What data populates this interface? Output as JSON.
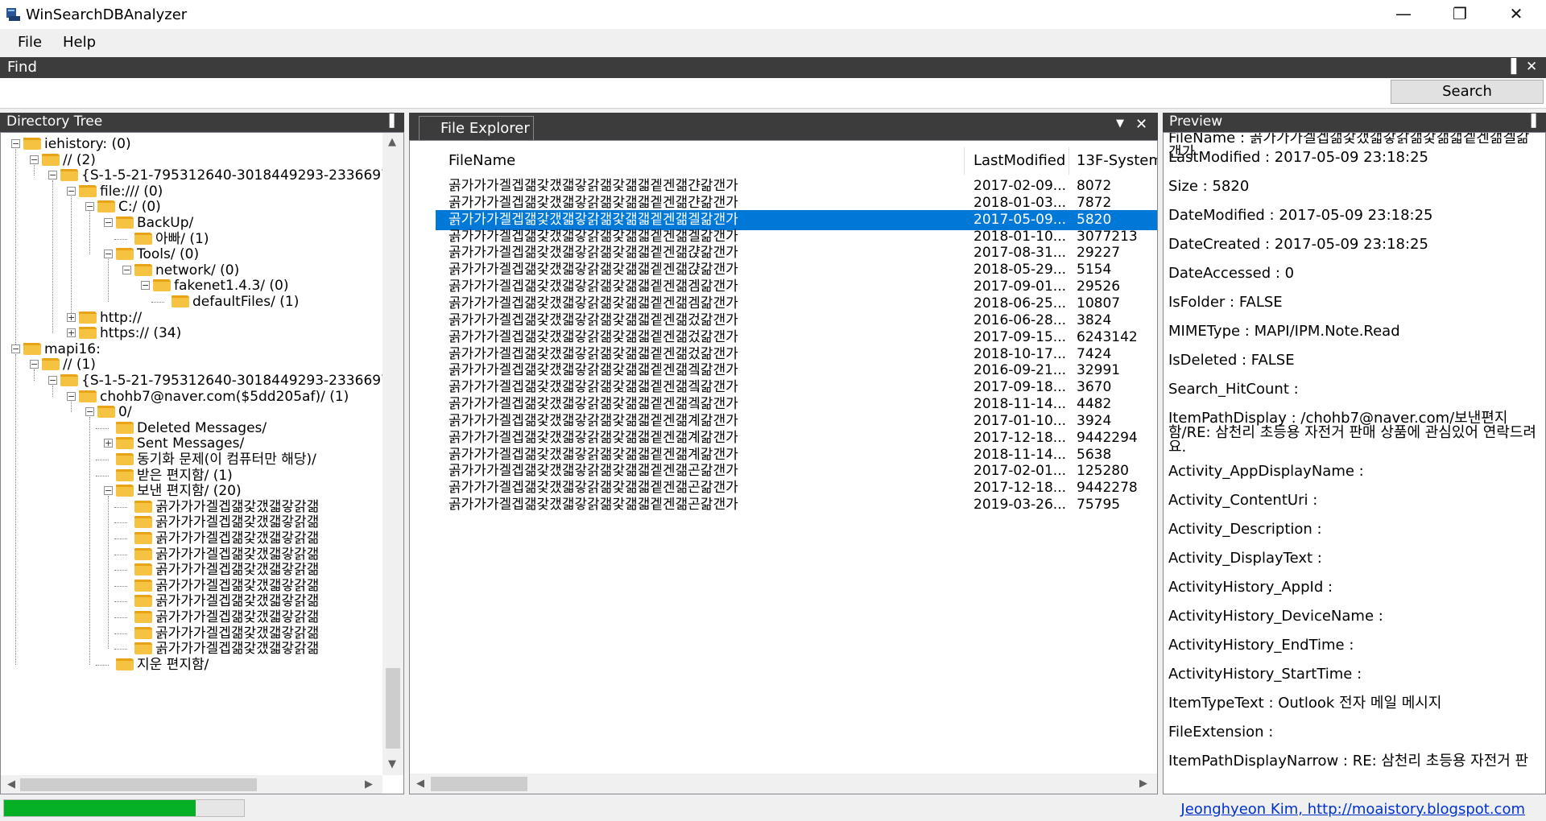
{
  "window": {
    "title": "WinSearchDBAnalyzer",
    "minimize_glyph": "—",
    "maximize_glyph": "❐",
    "close_glyph": "✕"
  },
  "menu": {
    "file": "File",
    "help": "Help"
  },
  "find": {
    "title": "Find",
    "search_value": "",
    "search_button": "Search"
  },
  "directory_tree": {
    "title": "Directory Tree",
    "nodes": [
      {
        "label": "iehistory: (0)",
        "expander": "−"
      },
      {
        "label": "// (2)",
        "expander": "−"
      },
      {
        "label": "{S-1-5-21-795312640-3018449293-2336697",
        "expander": "−"
      },
      {
        "label": "file:/// (0)",
        "expander": "−"
      },
      {
        "label": "C:/ (0)",
        "expander": "−"
      },
      {
        "label": "BackUp/",
        "expander": "−"
      },
      {
        "label": "아빠/ (1)",
        "expander": ""
      },
      {
        "label": "Tools/ (0)",
        "expander": "−"
      },
      {
        "label": "network/ (0)",
        "expander": "−"
      },
      {
        "label": "fakenet1.4.3/ (0)",
        "expander": "−"
      },
      {
        "label": "defaultFiles/ (1)",
        "expander": ""
      },
      {
        "label": "http://",
        "expander": "+"
      },
      {
        "label": "https:// (34)",
        "expander": "+"
      },
      {
        "label": "mapi16:",
        "expander": "−"
      },
      {
        "label": "// (1)",
        "expander": "−"
      },
      {
        "label": "{S-1-5-21-795312640-3018449293-2336697",
        "expander": "−"
      },
      {
        "label": "chohb7@naver.com($5dd205af)/ (1)",
        "expander": "−"
      },
      {
        "label": "0/",
        "expander": "−"
      },
      {
        "label": "Deleted Messages/",
        "expander": ""
      },
      {
        "label": "Sent Messages/",
        "expander": "+"
      },
      {
        "label": "동기화 문제(이 컴퓨터만 해당)/",
        "expander": ""
      },
      {
        "label": "받은 편지함/ (1)",
        "expander": ""
      },
      {
        "label": "보낸 편지함/ (20)",
        "expander": "−"
      },
      {
        "label": "곩가가가겔겝갦갗갰갧갛갉갦",
        "expander": ""
      },
      {
        "label": "곩가가가겔겝갦갗갰갧갛갉갦",
        "expander": ""
      },
      {
        "label": "곩가가가겔겝갦갗갰갧갛갉갦",
        "expander": ""
      },
      {
        "label": "곩가가가겔겝갦갗갰갧갛갉갦",
        "expander": ""
      },
      {
        "label": "곩가가가겔겝갦갗갰갧갛갉갦",
        "expander": ""
      },
      {
        "label": "곩가가가겔겝갦갗갰갧갛갉갦",
        "expander": ""
      },
      {
        "label": "곩가가가겔겝갦갗갰갧갛갉갦",
        "expander": ""
      },
      {
        "label": "곩가가가겔겝갦갗갰갧갛갉갦",
        "expander": ""
      },
      {
        "label": "곩가가가겔겝갦갗갰갧갛갉갦",
        "expander": ""
      },
      {
        "label": "곩가가가겔겝갦갗갰갧갛갉갦",
        "expander": ""
      },
      {
        "label": "지운 편지함/",
        "expander": ""
      }
    ]
  },
  "file_explorer": {
    "tab": "File Explorer",
    "columns": [
      "FileName",
      "LastModified",
      "13F-System"
    ],
    "rows": [
      {
        "name": "곩가가가겔겝갦갗갰갧갛갉갦갗갦갧겥겐갦갼갊갠가",
        "modified": "2017-02-09...",
        "size": "8072"
      },
      {
        "name": "곩가가가겔겝갦갗갰갧갛갉갦갗갦갧겥겐갦갼갊갠가",
        "modified": "2018-01-03...",
        "size": "7872"
      },
      {
        "name": "곩가가가겔겝갦갗갰갧갛갉갦갗갦갧겥겐갦겔갊갠가",
        "modified": "2017-05-09...",
        "size": "5820"
      },
      {
        "name": "곩가가가겔겝갦갗갰갧갛갉갦갗갦갧겥겐갦겔갊갠가",
        "modified": "2018-01-10...",
        "size": "3077213"
      },
      {
        "name": "곩가가가겔겝갦갗갰갧갛갉갦갗갦갧겥겐갦갽갊갠가",
        "modified": "2017-08-31...",
        "size": "29227"
      },
      {
        "name": "곩가가가겔겝갦갗갰갧갛갉갦갗갦갧겥겐갦갽갊갠가",
        "modified": "2018-05-29...",
        "size": "5154"
      },
      {
        "name": "곩가가가겔겝갦갗갰갧갛갉갦갗갦갧겥겐갦겜갊갠가",
        "modified": "2017-09-01...",
        "size": "29526"
      },
      {
        "name": "곩가가가겔겝갦갗갰갧갛갉갦갗갦갧겥겐갦겜갊갠가",
        "modified": "2018-06-25...",
        "size": "10807"
      },
      {
        "name": "곩가가가겔겝갦갗갰갧갛갉갦갗갦갧겥겐갦겄갊갠가",
        "modified": "2016-06-28...",
        "size": "3824"
      },
      {
        "name": "곩가가가겔겝갦갗갰갧갛갉갦갗갦갧겥겐갦겄갊갠가",
        "modified": "2017-09-15...",
        "size": "6243142"
      },
      {
        "name": "곩가가가겔겝갦갗갰갧갛갉갦갗갦갧겥겐갦겄갊갠가",
        "modified": "2018-10-17...",
        "size": "7424"
      },
      {
        "name": "곩가가가겔겝갦갗갰갧갛갉갦갗갦갧겥겐갦겤갊갠가",
        "modified": "2016-09-21...",
        "size": "32991"
      },
      {
        "name": "곩가가가겔겝갦갗갰갧갛갉갦갗갦갧겥겐갦겤갊갠가",
        "modified": "2017-09-18...",
        "size": "3670"
      },
      {
        "name": "곩가가가겔겝갦갗갰갧갛갉갦갗갦갧겥겐갦겤갊갠가",
        "modified": "2018-11-14...",
        "size": "4482"
      },
      {
        "name": "곩가가가겔겝갦갗갰갧갛갉갦갗갦갧겥겐갦계갊갠가",
        "modified": "2017-01-10...",
        "size": "3924"
      },
      {
        "name": "곩가가가겔겝갦갗갰갧갛갉갦갗갦갧겥겐갦계갊갠가",
        "modified": "2017-12-18...",
        "size": "9442294"
      },
      {
        "name": "곩가가가겔겝갦갗갰갧갛갉갦갗갦갧겥겐갦계갊갠가",
        "modified": "2018-11-14...",
        "size": "5638"
      },
      {
        "name": "곩가가가겔겝갦갗갰갧갛갉갦갗갦갧겥겐갦곤갊갠가",
        "modified": "2017-02-01...",
        "size": "125280"
      },
      {
        "name": "곩가가가겔겝갦갗갰갧갛갉갦갗갦갧겥겐갦곤갊갠가",
        "modified": "2017-12-18...",
        "size": "9442278"
      },
      {
        "name": "곩가가가겔겝갦갗갰갧갛갉갦갗갦갧겥겐갦곤갊갠가",
        "modified": "2019-03-26...",
        "size": "75795"
      }
    ],
    "selected_index": 2
  },
  "preview": {
    "title": "Preview",
    "properties": [
      {
        "text": "FileName : 곩가가가겔겝갦갗갰갧갛갉갦갗갦갧겥겐갦겔갊갠가"
      },
      {
        "text": "LastModified : 2017-05-09 23:18:25"
      },
      {
        "text": "Size : 5820"
      },
      {
        "text": "DateModified : 2017-05-09 23:18:25"
      },
      {
        "text": "DateCreated : 2017-05-09 23:18:25"
      },
      {
        "text": "DateAccessed : 0"
      },
      {
        "text": "IsFolder : FALSE"
      },
      {
        "text": "MIMEType : MAPI/IPM.Note.Read"
      },
      {
        "text": "IsDeleted : FALSE"
      },
      {
        "text": "Search_HitCount :"
      },
      {
        "text": "ItemPathDisplay : /chohb7@naver.com/보낸편지함/RE: 삼천리 초등용 자전거 판매 상품에 관심있어 연락드려요."
      },
      {
        "text": "Activity_AppDisplayName :"
      },
      {
        "text": "Activity_ContentUri :"
      },
      {
        "text": "Activity_Description :"
      },
      {
        "text": "Activity_DisplayText :"
      },
      {
        "text": "ActivityHistory_AppId :"
      },
      {
        "text": "ActivityHistory_DeviceName :"
      },
      {
        "text": "ActivityHistory_EndTime :"
      },
      {
        "text": "ActivityHistory_StartTime :"
      },
      {
        "text": "ItemTypeText : Outlook 전자 메일 메시지"
      },
      {
        "text": "FileExtension :"
      },
      {
        "text": "ItemPathDisplayNarrow : RE: 삼천리 초등용 자전거 판"
      }
    ]
  },
  "status": {
    "progress_fraction": 0.8,
    "author_link": "Jeonghyeon Kim, http://moaistory.blogspot.com"
  },
  "colors": {
    "header_bg": "#3c3c3c",
    "selection": "#0078d7",
    "progress": "#06b025",
    "link": "#0033cc",
    "folder": "#f6c242"
  }
}
